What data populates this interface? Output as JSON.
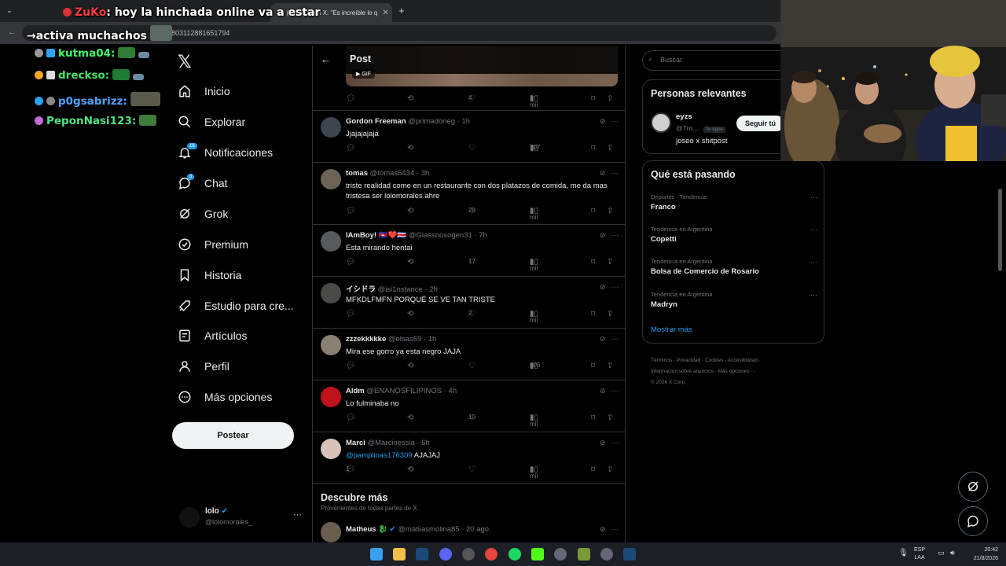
{
  "browser": {
    "tabs": [
      {
        "label": "(18) eyzs en X: \"Es increíble lo q",
        "active": true
      }
    ],
    "url": "2090803112881651794"
  },
  "stream_chat": {
    "overlay_name": "ZuKo",
    "overlay_text": ": hoy la hinchada online va a estar",
    "overlay_text_2": "activa muchachos",
    "lines": [
      {
        "user": "kutma04:",
        "color": "#3cff6b"
      },
      {
        "user": "drecksо:",
        "color": "#43e36b"
      },
      {
        "user": "p0gsabrizz:",
        "color": "#4fa3ff"
      },
      {
        "user": "PeponNasi123:",
        "color": "#4fe384"
      }
    ]
  },
  "nav": {
    "items": [
      {
        "label": "Inicio",
        "icon": "home-icon"
      },
      {
        "label": "Explorar",
        "icon": "search-icon"
      },
      {
        "label": "Notificaciones",
        "icon": "bell-icon",
        "badge": "16"
      },
      {
        "label": "Chat",
        "icon": "chat-icon",
        "badge": "3"
      },
      {
        "label": "Grok",
        "icon": "grok-icon"
      },
      {
        "label": "Premium",
        "icon": "premium-icon"
      },
      {
        "label": "Historia",
        "icon": "bookmark-icon"
      },
      {
        "label": "Estudio para cre...",
        "icon": "rocket-icon"
      },
      {
        "label": "Artículos",
        "icon": "article-icon"
      },
      {
        "label": "Perfil",
        "icon": "person-icon"
      },
      {
        "label": "Más opciones",
        "icon": "more-circle-icon"
      }
    ],
    "post_button": "Postear",
    "account": {
      "name": "lolo",
      "handle": "@lolomorales_"
    }
  },
  "main": {
    "title": "Post",
    "gif_label": "GIF",
    "top_post_stats": {
      "likes": "4",
      "views": "3 mil"
    },
    "replies": [
      {
        "name": "Gordon Freeman",
        "handle": "@primadoneg",
        "time": "· 1h",
        "text": "Jjajajajaja",
        "replies": "",
        "likes": "",
        "views": "707",
        "avatar": "#3d4650"
      },
      {
        "name": "tomas",
        "handle": "@tomas6434",
        "time": "· 3h",
        "text": "triste realidad come en un restaurante con dos platazos de comida, me da mas tristesa ser lolomorales ahre",
        "replies": "",
        "likes": "28",
        "views": "1 mil",
        "avatar": "#6b6356"
      },
      {
        "name": "lAmBoy! 🇰🇭❤️🇨🇷",
        "handle": "@Glassnosogen31",
        "time": "· 7h",
        "text": "Esta mirando hentai",
        "replies": "",
        "likes": "17",
        "views": "2 mil",
        "avatar": "#555a5e"
      },
      {
        "name": "イシドラ",
        "handle": "@isi1nstance",
        "time": "· 2h",
        "text": "MFKDLFMFN PORQUÉ SE VE TAN TRISTE",
        "replies": "",
        "likes": "2",
        "views": "1 mil",
        "avatar": "#4a4a48"
      },
      {
        "name": "zzzekkkkke",
        "handle": "@elsas69",
        "time": "· 1h",
        "text": "Mira ese gorro ya esta negro JAJA",
        "replies": "",
        "likes": "",
        "views": "606",
        "avatar": "#8a7f73"
      },
      {
        "name": "Aldm",
        "handle": "@ENANOSFILIPINOS",
        "time": "· 4h",
        "text": "Lo fulminaba no",
        "replies": "",
        "likes": "10",
        "views": "1 mil",
        "avatar": "#c0121b"
      },
      {
        "name": "Marci",
        "handle": "@Marcinessia",
        "time": "· 6h",
        "mention": "@pamplinas176309",
        "text": "AJAJAJ",
        "replies": "1",
        "likes": "",
        "views": "1 mil",
        "avatar": "#d7c3b8"
      }
    ],
    "discover": {
      "title": "Descubre más",
      "subtitle": "Provenientes de todas partes de X",
      "first": {
        "name": "Matheus 🐉",
        "handle": "@matiiasmolina85",
        "time": "· 20 ago."
      }
    }
  },
  "right": {
    "search_placeholder": "Buscar",
    "relevant": {
      "title": "Personas relevantes",
      "name": "eyzs",
      "handle": "@Tro...",
      "follows_you": "Te sigue",
      "follow_button": "Seguir tú",
      "bio": "joseo x shitpost"
    },
    "trends": {
      "title": "Qué está pasando",
      "items": [
        {
          "category": "Deportes · Tendencia",
          "title": "Franco"
        },
        {
          "category": "Tendencia en Argentina",
          "title": "Copetti"
        },
        {
          "category": "Tendencia en Argentina",
          "title": "Bolsa de Comercio de Rosario"
        },
        {
          "category": "Tendencia en Argentina",
          "title": "Madryn"
        }
      ],
      "show_more": "Mostrar más"
    },
    "footer_line1": "Términos  ·  Privacidad  ·  Cookies  ·  Accesibilidad  ·",
    "footer_line2": "Información sobre anuncios  ·  Más opciones ···",
    "footer_line3": "© 2026 X Corp."
  },
  "taskbar": {
    "lang": "ESP",
    "lang2": "LAA",
    "time": "20:42",
    "date": "21/8/2026"
  }
}
